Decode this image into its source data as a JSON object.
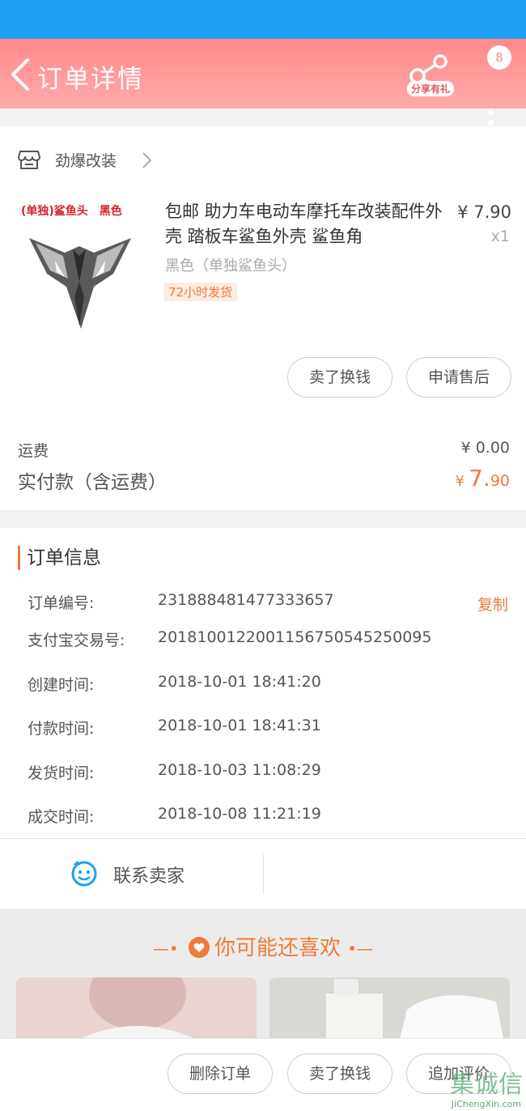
{
  "header": {
    "title": "订单详情",
    "share_label": "分享有礼",
    "message_count": "8"
  },
  "shop": {
    "name": "劲爆改装"
  },
  "product": {
    "image_label": "(单独)鲨鱼头　黑色",
    "title": "包邮 助力车电动车摩托车改装配件外壳 踏板车鲨鱼外壳 鲨鱼角",
    "price": "¥ 7.90",
    "quantity": "x1",
    "sku": "黑色（单独鲨鱼头）",
    "tag": "72小时发货"
  },
  "item_actions": {
    "sell": "卖了换钱",
    "after_sale": "申请售后"
  },
  "summary": {
    "shipping_label": "运费",
    "shipping_value": "¥ 0.00",
    "total_label": "实付款（含运费）",
    "total_currency": "¥",
    "total_int": "7.",
    "total_dec": "90"
  },
  "order_info": {
    "title": "订单信息",
    "copy_label": "复制",
    "rows": [
      {
        "label": "订单编号:",
        "value": "231888481477333657"
      },
      {
        "label": "支付宝交易号:",
        "value": "2018100122001156750545250095"
      },
      {
        "label": "创建时间:",
        "value": "2018-10-01 18:41:20"
      },
      {
        "label": "付款时间:",
        "value": "2018-10-01 18:41:31"
      },
      {
        "label": "发货时间:",
        "value": "2018-10-03 11:08:29"
      },
      {
        "label": "成交时间:",
        "value": "2018-10-08 11:21:19"
      }
    ]
  },
  "contact": {
    "label": "联系卖家"
  },
  "recommend": {
    "title": "你可能还喜欢"
  },
  "bottom_actions": {
    "delete": "删除订单",
    "sell": "卖了换钱",
    "review": "追加评价"
  },
  "watermark": {
    "brand": "集诚信",
    "url": "JiChengXin.com"
  },
  "colors": {
    "accent": "#f07a3a",
    "header": "#ff8f8f",
    "statusbar": "#1ea1f2"
  }
}
